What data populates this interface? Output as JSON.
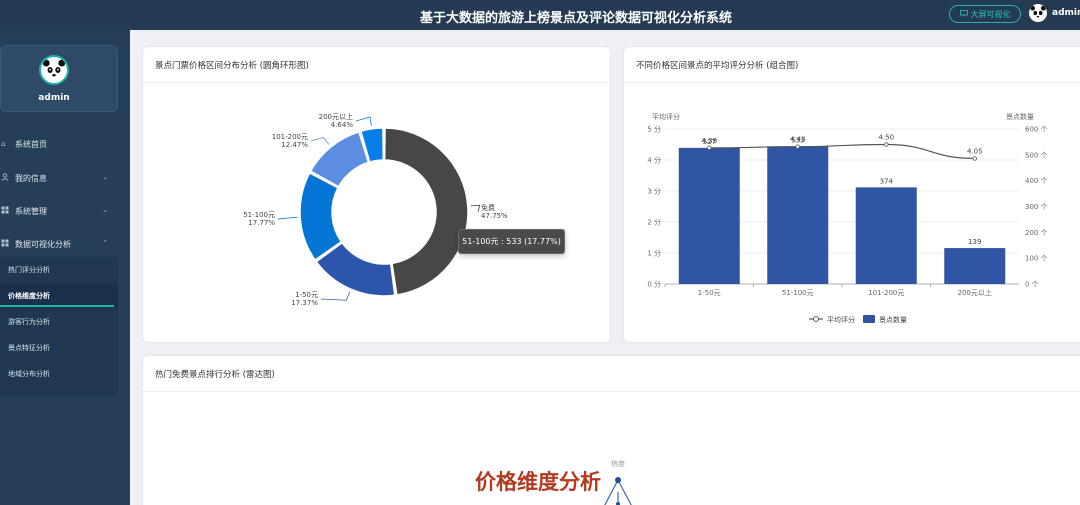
{
  "header": {
    "title": "基于大数据的旅游上榜景点及评论数据可视化分析系统",
    "bigscreen_label": "大屏可视化",
    "username": "admin"
  },
  "sidebar": {
    "username": "admin",
    "menu": [
      {
        "label": "系统首页",
        "icon": "home-icon"
      },
      {
        "label": "我的信息",
        "icon": "user-icon"
      },
      {
        "label": "系统管理",
        "icon": "grid-icon"
      },
      {
        "label": "数据可视化分析",
        "icon": "grid-icon"
      }
    ],
    "submenu": [
      {
        "label": "热门评分分析"
      },
      {
        "label": "价格维度分析",
        "active": true
      },
      {
        "label": "游客行为分析"
      },
      {
        "label": "景点特征分析"
      },
      {
        "label": "地域分布分析"
      }
    ]
  },
  "cards": {
    "donut_title": "景点门票价格区间分布分析 (圆角环形图)",
    "combo_title": "不同价格区间景点的平均评分分析 (组合图)",
    "radar_title": "热门免费景点排行分析 (雷达图)"
  },
  "tooltip": {
    "text": "51-100元 : 533 (17.77%)"
  },
  "watermark": "价格维度分析",
  "colors": {
    "accent": "#1bb3a0",
    "sidebar": "#263f58",
    "topbar": "#243b53",
    "bar": "#2f55a4",
    "watermark": "#b23a1f"
  },
  "chart_data": [
    {
      "type": "pie",
      "variant": "donut",
      "slices": [
        {
          "label": "免费",
          "percent": "47.75%",
          "value": 47.75,
          "color": "#474747"
        },
        {
          "label": "1-50元",
          "percent": "17.37%",
          "value": 17.37,
          "color": "#2c56ab"
        },
        {
          "label": "51-100元",
          "percent": "17.77%",
          "value": 17.77,
          "color": "#0575d6"
        },
        {
          "label": "101-200元",
          "percent": "12.47%",
          "value": 12.47,
          "color": "#5b8ee0"
        },
        {
          "label": "200元以上",
          "percent": "4.64%",
          "value": 4.64,
          "color": "#0a7ee8"
        }
      ]
    },
    {
      "type": "bar",
      "categories": [
        "1-50元",
        "51-100元",
        "101-200元",
        "200元以上"
      ],
      "y_left_label": "平均评分",
      "y_right_label": "景点数量",
      "y_left_ticks": [
        "0 分",
        "1 分",
        "2 分",
        "3 分",
        "4 分",
        "5 分"
      ],
      "y_right_ticks": [
        "0 个",
        "100 个",
        "200 个",
        "300 个",
        "400 个",
        "500 个",
        "600 个"
      ],
      "ylim_left": [
        0,
        5
      ],
      "ylim_right": [
        0,
        600
      ],
      "series": [
        {
          "name": "景点数量",
          "type": "bar",
          "axis": "right",
          "values": [
            527,
            533,
            374,
            139
          ],
          "labels": [
            "527",
            "533",
            "374",
            "139"
          ]
        },
        {
          "name": "平均评分",
          "type": "line",
          "axis": "left",
          "values": [
            4.39,
            4.43,
            4.5,
            4.05
          ],
          "labels": [
            "4.39",
            "4.43",
            "4.50",
            "4.05"
          ]
        }
      ]
    },
    {
      "type": "radar",
      "indicators": [
        "热度"
      ]
    }
  ]
}
